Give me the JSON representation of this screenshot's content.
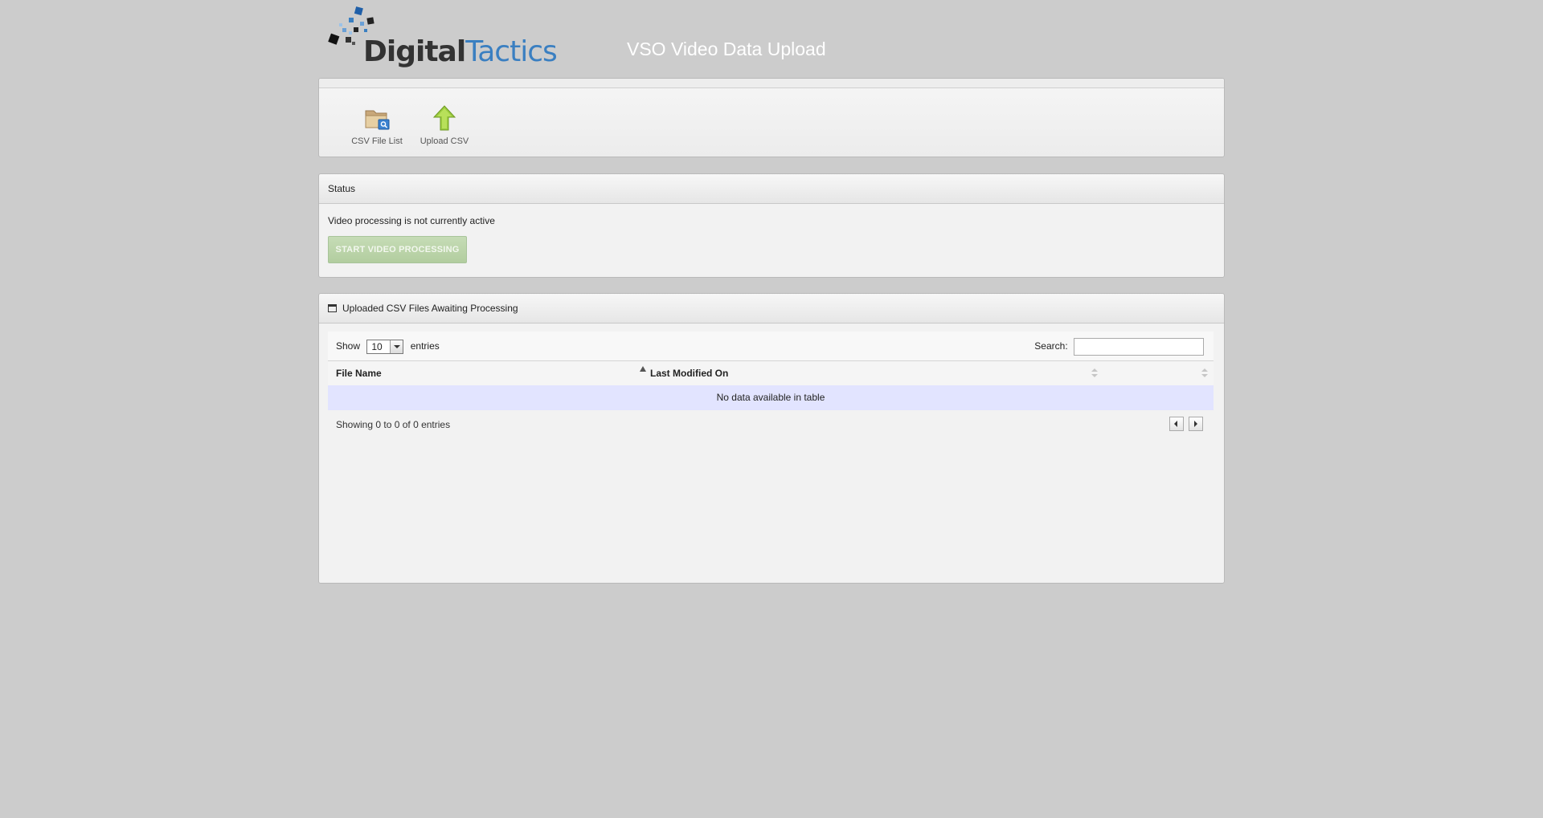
{
  "header": {
    "logo_part1": "Digital",
    "logo_part2": "Tactics",
    "title": "VSO Video Data Upload"
  },
  "toolbar": {
    "items": [
      {
        "label": "CSV File List",
        "icon": "folder-search-icon"
      },
      {
        "label": "Upload CSV",
        "icon": "upload-arrow-icon"
      }
    ]
  },
  "status": {
    "title": "Status",
    "message": "Video processing is not currently active",
    "button_label": "START VIDEO PROCESSING"
  },
  "files": {
    "title": "Uploaded CSV Files Awaiting Processing",
    "show_label": "Show",
    "entries_value": "10",
    "entries_label": "entries",
    "search_label": "Search:",
    "search_value": "",
    "columns": [
      "File Name",
      "Last Modified On",
      ""
    ],
    "empty_message": "No data available in table",
    "info": "Showing 0 to 0 of 0 entries"
  },
  "colors": {
    "background": "#cccccc",
    "logo_blue": "#3a7fc1",
    "empty_row": "#e2e4ff",
    "start_button": "#b9d2a6"
  }
}
